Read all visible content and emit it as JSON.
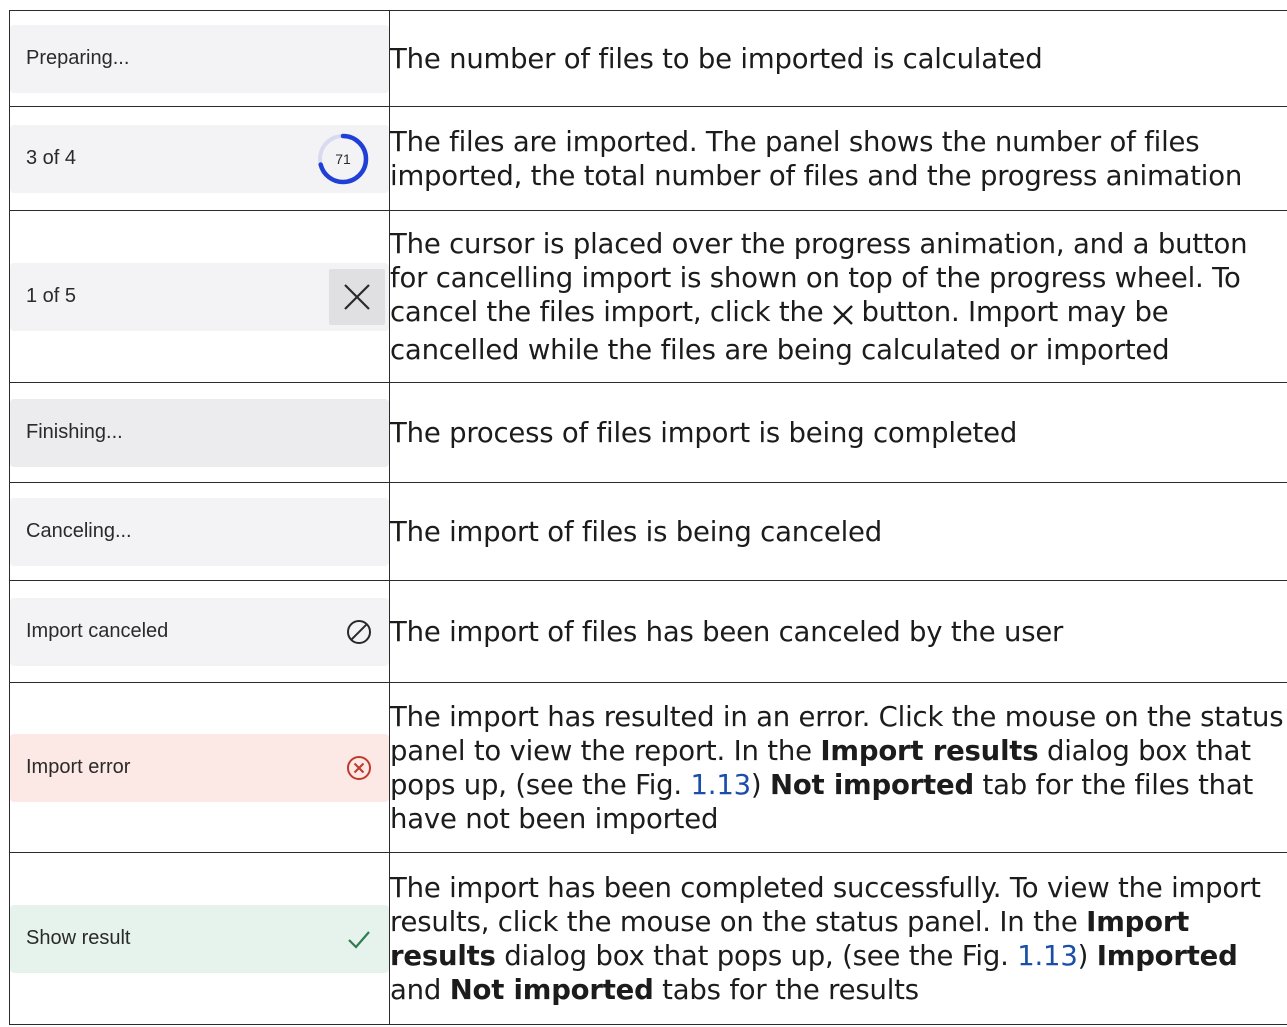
{
  "rows": [
    {
      "panel": {
        "label": "Preparing...",
        "variant": "neutral",
        "icon": "none"
      },
      "description": "The number of files to be imported is calculated"
    },
    {
      "panel": {
        "label": "3 of 4",
        "variant": "neutral",
        "icon": "progress-ring-icon",
        "progress_value": "71",
        "progress_percent": 71
      },
      "description": "The files are imported. The panel shows the number of files imported, the total number of files and the progress animation"
    },
    {
      "panel": {
        "label": "1 of 5",
        "variant": "neutral",
        "icon": "close-icon"
      },
      "description_parts": {
        "p1": "The cursor is placed over the progress animation, and a button for cancelling import is shown on top of the progress wheel. To cancel the files import, click the",
        "p2": "button. Import may be cancelled while the files are being calculated or imported"
      }
    },
    {
      "panel": {
        "label": "Finishing...",
        "variant": "neutral",
        "icon": "none"
      },
      "description": "The process of files import is being completed"
    },
    {
      "panel": {
        "label": "Canceling...",
        "variant": "neutral",
        "icon": "none"
      },
      "description": "The import of files is being canceled"
    },
    {
      "panel": {
        "label": "Import canceled",
        "variant": "neutral",
        "icon": "prohibited-icon"
      },
      "description": "The import of files has been canceled by the user"
    },
    {
      "panel": {
        "label": "Import error",
        "variant": "error",
        "icon": "error-circle-icon"
      },
      "description_parts": {
        "p1": "The import has resulted in an error. Click the mouse on the status panel to view the report. In the",
        "b1": "Import results",
        "p2": "dialog box that pops up, (see the Fig.",
        "ref": "1.13",
        "p3": ")",
        "b2": "Not imported",
        "p4": "tab for the files that have not been imported"
      }
    },
    {
      "panel": {
        "label": "Show result",
        "variant": "success",
        "icon": "check-icon"
      },
      "description_parts": {
        "p1": "The import has been completed successfully. To view the import results, click the mouse on the status panel. In the",
        "b1": "Import results",
        "p2": "dialog box that pops up, (see the Fig.",
        "ref": "1.13",
        "p3": ")",
        "b2": "Imported",
        "p4": "and",
        "b3": "Not imported",
        "p5": "tabs for the results"
      }
    }
  ],
  "colors": {
    "panel_neutral": "#f3f3f6",
    "panel_error": "#fce9e6",
    "panel_success": "#e6f3ec",
    "progress_ring": "#1f3fd6",
    "error_icon": "#c0392b",
    "success_icon": "#2e7d52",
    "link": "#1a4ea8"
  }
}
